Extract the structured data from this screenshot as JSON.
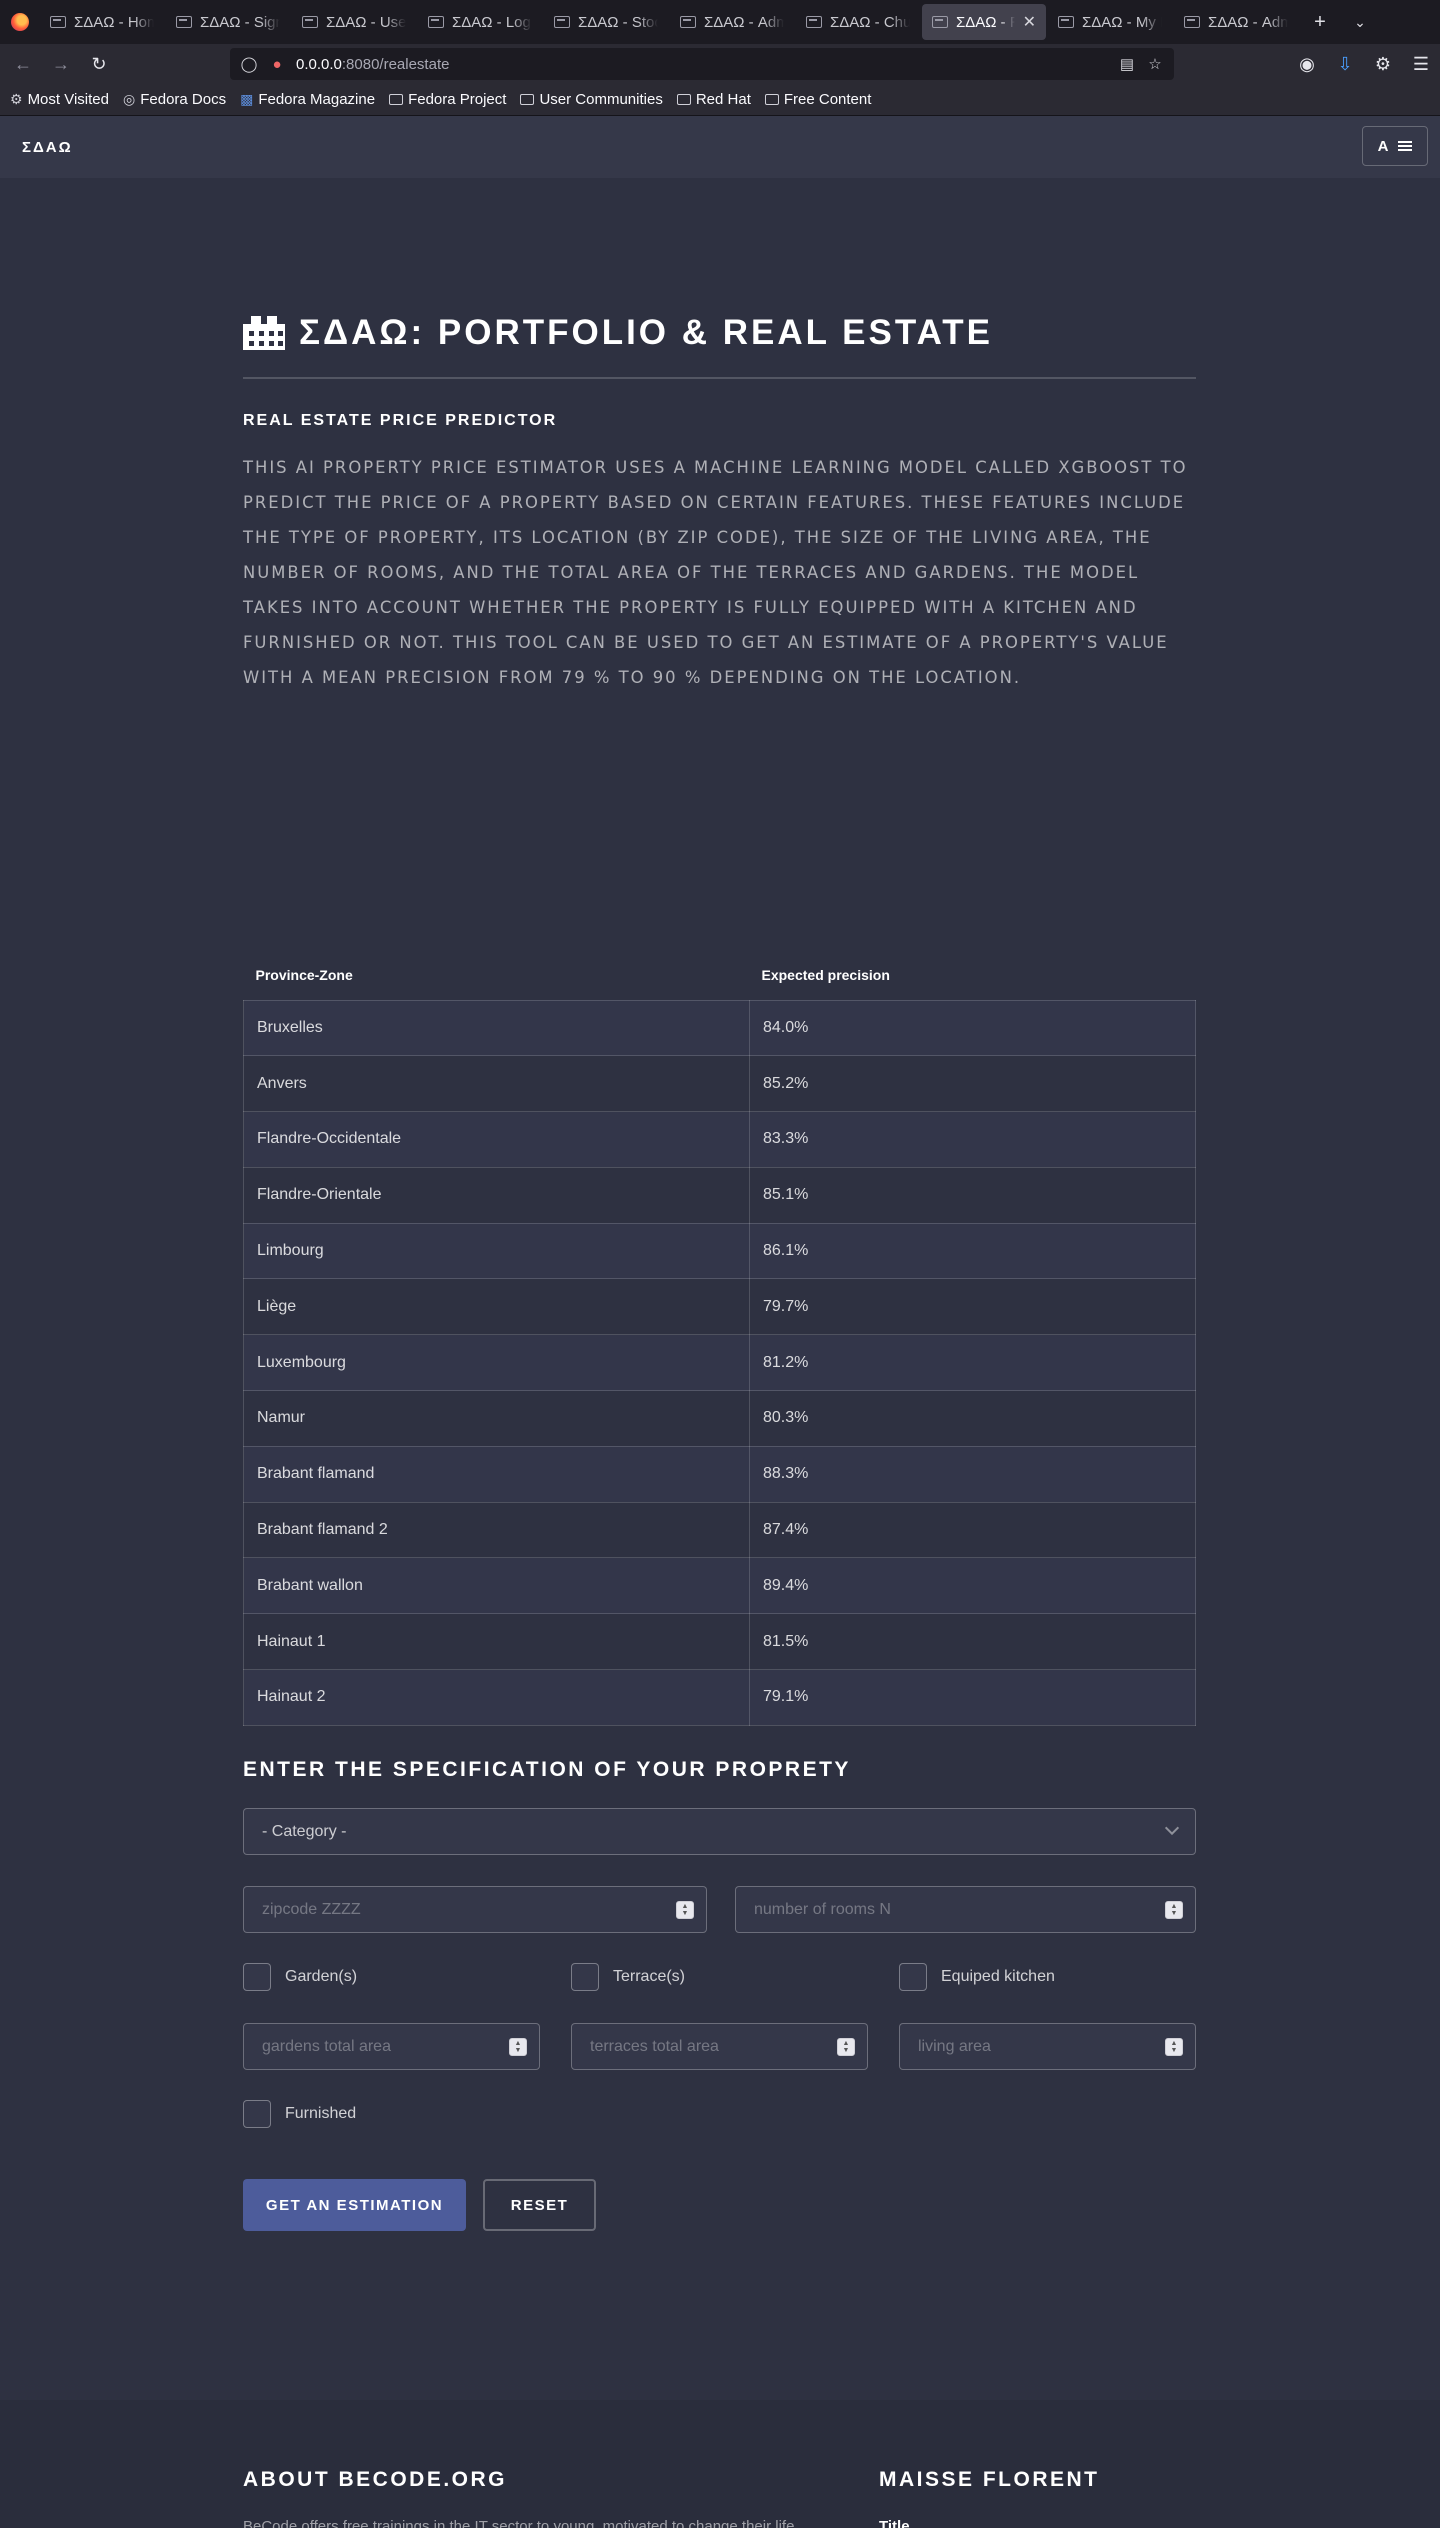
{
  "browser": {
    "tabs": [
      {
        "title": "ΣΔΑΩ - Home",
        "active": false
      },
      {
        "title": "ΣΔΑΩ - Signup",
        "active": false
      },
      {
        "title": "ΣΔΑΩ - Users",
        "active": false
      },
      {
        "title": "ΣΔΑΩ - Login",
        "active": false
      },
      {
        "title": "ΣΔΑΩ - Stock",
        "active": false
      },
      {
        "title": "ΣΔΑΩ - Admin",
        "active": false
      },
      {
        "title": "ΣΔΑΩ - Churn",
        "active": false
      },
      {
        "title": "ΣΔΑΩ - Real Estate",
        "active": true
      },
      {
        "title": "ΣΔΑΩ - My Profile",
        "active": false
      },
      {
        "title": "ΣΔΑΩ - Admin",
        "active": false
      }
    ],
    "url_host": "0.0.0.0",
    "url_rest": ":8080/realestate",
    "bookmarks": [
      "Most Visited",
      "Fedora Docs",
      "Fedora Magazine",
      "Fedora Project",
      "User Communities",
      "Red Hat",
      "Free Content"
    ]
  },
  "header": {
    "logo": "ΣΔΑΩ",
    "menu_label": "A"
  },
  "page": {
    "title": "ΣΔΑΩ: PORTFOLIO & REAL ESTATE",
    "section_title": "REAL ESTATE PRICE PREDICTOR",
    "description": "THIS AI PROPERTY PRICE ESTIMATOR USES A MACHINE LEARNING MODEL CALLED XGBOOST TO PREDICT THE PRICE OF A PROPERTY BASED ON CERTAIN FEATURES. THESE FEATURES INCLUDE THE TYPE OF PROPERTY, ITS LOCATION (BY ZIP CODE), THE SIZE OF THE LIVING AREA, THE NUMBER OF ROOMS, AND THE TOTAL AREA OF THE TERRACES AND GARDENS. THE MODEL TAKES INTO ACCOUNT WHETHER THE PROPERTY IS FULLY EQUIPPED WITH A KITCHEN AND FURNISHED OR NOT. THIS TOOL CAN BE USED TO GET AN ESTIMATE OF A PROPERTY'S VALUE WITH A MEAN PRECISION FROM 79 % TO 90 % DEPENDING ON THE LOCATION."
  },
  "table": {
    "headers": [
      "Province-Zone",
      "Expected precision"
    ],
    "rows": [
      [
        "Bruxelles",
        "84.0%"
      ],
      [
        "Anvers",
        "85.2%"
      ],
      [
        "Flandre-Occidentale",
        "83.3%"
      ],
      [
        "Flandre-Orientale",
        "85.1%"
      ],
      [
        "Limbourg",
        "86.1%"
      ],
      [
        "Liège",
        "79.7%"
      ],
      [
        "Luxembourg",
        "81.2%"
      ],
      [
        "Namur",
        "80.3%"
      ],
      [
        "Brabant flamand",
        "88.3%"
      ],
      [
        "Brabant flamand 2",
        "87.4%"
      ],
      [
        "Brabant wallon",
        "89.4%"
      ],
      [
        "Hainaut 1",
        "81.5%"
      ],
      [
        "Hainaut 2",
        "79.1%"
      ]
    ]
  },
  "form": {
    "title": "ENTER THE SPECIFICATION OF YOUR PROPRETY",
    "category_placeholder": "- Category -",
    "zipcode_placeholder": "zipcode ZZZZ",
    "rooms_placeholder": "number of rooms N",
    "garden_label": "Garden(s)",
    "terrace_label": "Terrace(s)",
    "kitchen_label": "Equiped kitchen",
    "gardens_area_placeholder": "gardens total area",
    "terraces_area_placeholder": "terraces total area",
    "living_area_placeholder": "living area",
    "furnished_label": "Furnished",
    "submit_label": "GET AN ESTIMATION",
    "reset_label": "RESET"
  },
  "footer": {
    "about_title": "ABOUT BECODE.ORG",
    "about_text": "BeCode offers free trainings in the IT sector to young, motivated to change their life",
    "contact_title": "MAISSE FLORENT",
    "contact_sub": "Title"
  }
}
